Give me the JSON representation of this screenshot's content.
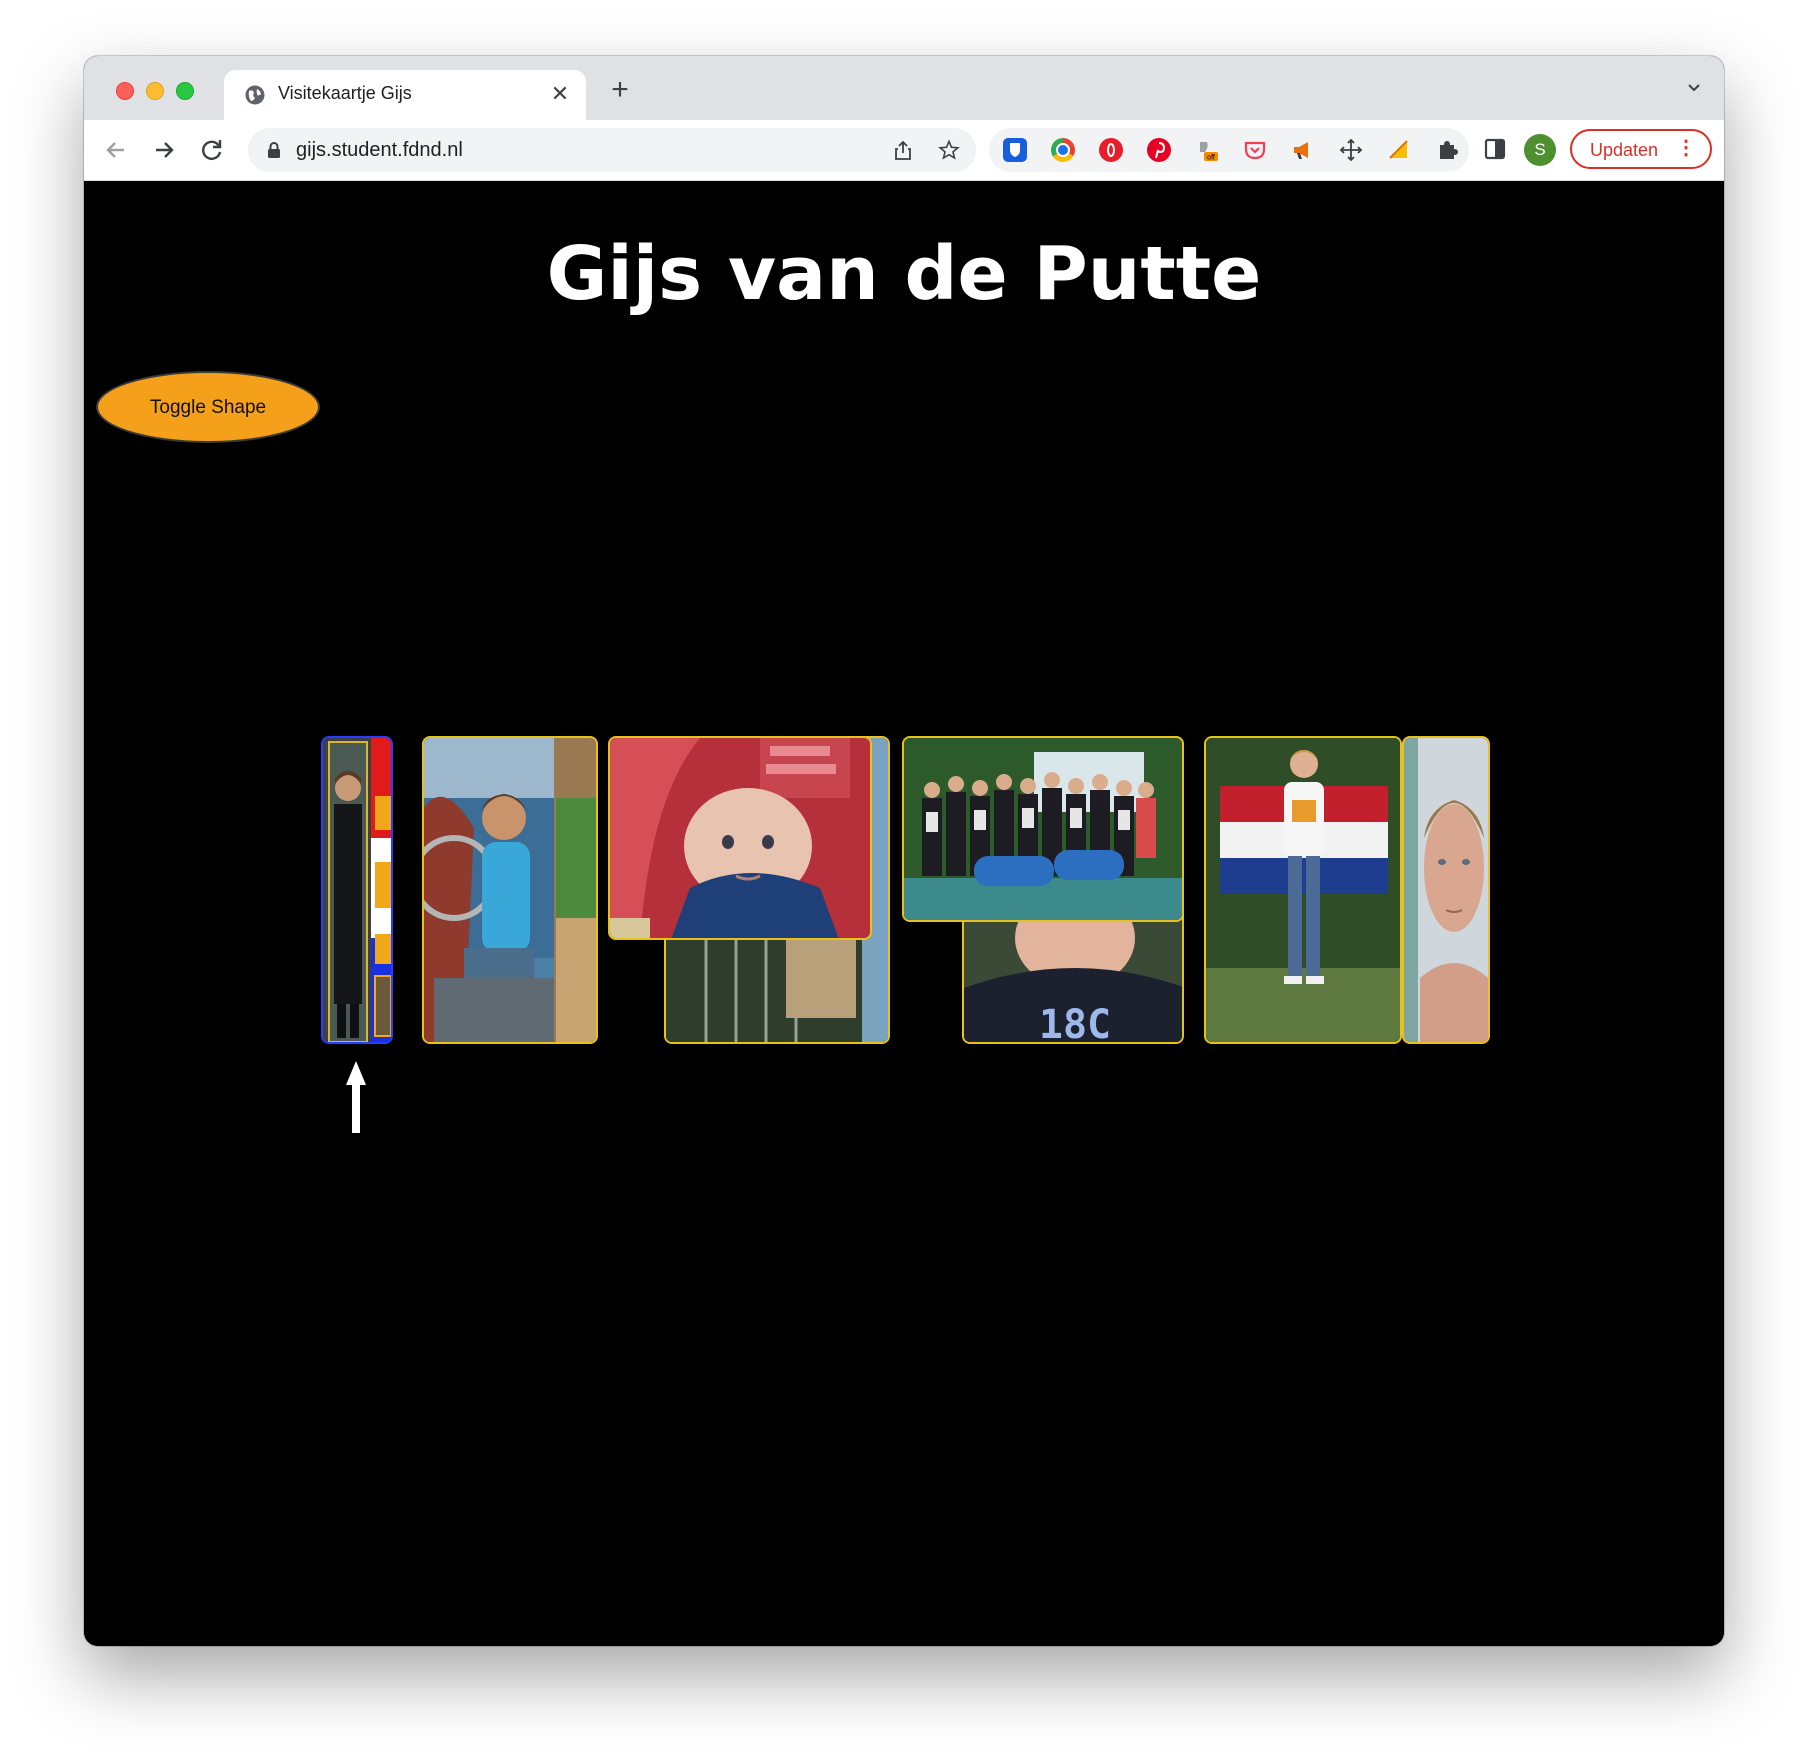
{
  "browser": {
    "tab_title": "Visitekaartje Gijs",
    "url": "gijs.student.fdnd.nl",
    "update_label": "Updaten",
    "avatar_initial": "S",
    "ext_badge": "off"
  },
  "page": {
    "title": "Gijs van de Putte",
    "toggle_label": "Toggle Shape"
  }
}
